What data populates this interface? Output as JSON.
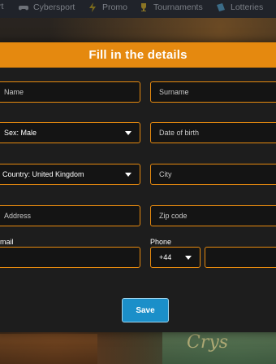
{
  "topnav": {
    "items": [
      {
        "label": "rt",
        "icon": "sports-icon"
      },
      {
        "label": "Cybersport",
        "icon": "controller-icon"
      },
      {
        "label": "Promo",
        "icon": "lightning-icon"
      },
      {
        "label": "Tournaments",
        "icon": "trophy-icon"
      },
      {
        "label": "Lotteries",
        "icon": "ticket-icon"
      }
    ]
  },
  "modal": {
    "title": "Fill in the details",
    "fields": {
      "name_placeholder": "Name",
      "surname_placeholder": "Surname",
      "sex_value": "Sex: Male",
      "dob_placeholder": "Date of birth",
      "country_value": "Country: United Kingdom",
      "city_placeholder": "City",
      "address_placeholder": "Address",
      "zip_placeholder": "Zip code",
      "email_label": "mail",
      "phone_label": "Phone",
      "phone_code": "+44"
    },
    "save_label": "Save"
  },
  "colors": {
    "accent": "#e5890f",
    "button": "#1b8fc9",
    "modal_bg": "#1d1d1d"
  }
}
